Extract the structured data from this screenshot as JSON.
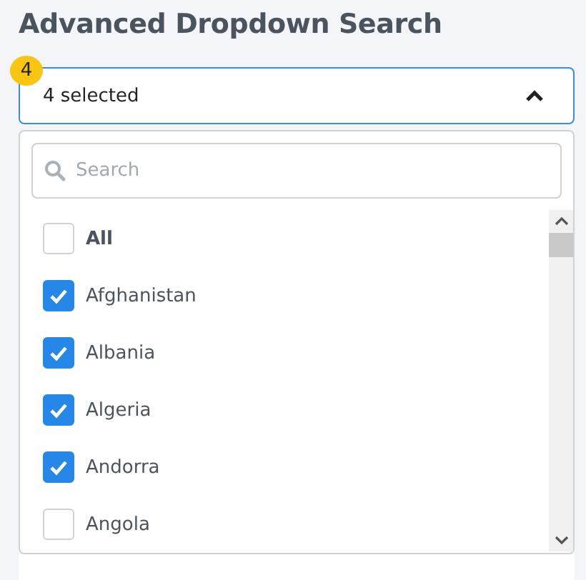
{
  "title": "Advanced Dropdown Search",
  "select": {
    "badge": "4",
    "value": "4 selected",
    "expanded": true
  },
  "search": {
    "placeholder": "Search"
  },
  "options": [
    {
      "label": "All",
      "kind": "all",
      "checked": false
    },
    {
      "label": "Afghanistan",
      "kind": "item",
      "checked": true
    },
    {
      "label": "Albania",
      "kind": "item",
      "checked": true
    },
    {
      "label": "Algeria",
      "kind": "item",
      "checked": true
    },
    {
      "label": "Andorra",
      "kind": "item",
      "checked": true
    },
    {
      "label": "Angola",
      "kind": "item",
      "checked": false
    }
  ]
}
